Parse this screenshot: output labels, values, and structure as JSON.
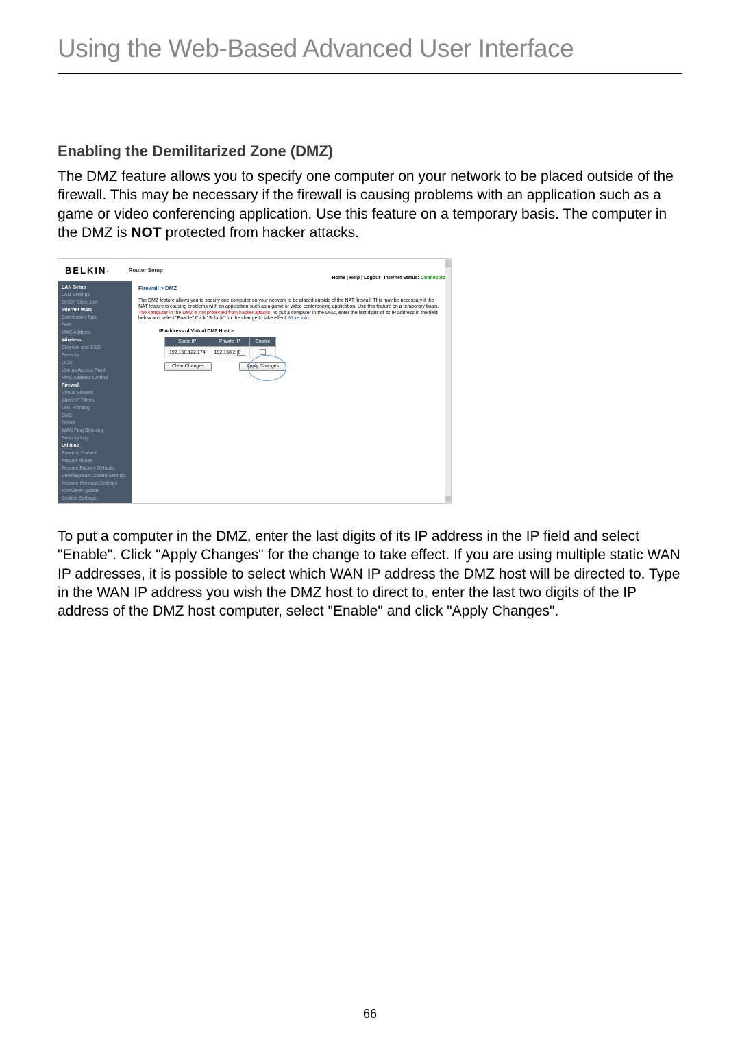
{
  "page": {
    "title": "Using the Web-Based Advanced User Interface",
    "section_heading": "Enabling the Demilitarized Zone (DMZ)",
    "intro_p1": "The DMZ feature allows you to specify one computer on your network to be placed outside of the firewall. This may be necessary if the firewall is causing problems with an application such as a game or video conferencing application. Use this feature on a temporary basis. The computer in the DMZ is ",
    "intro_bold": "NOT",
    "intro_p2": " protected from hacker attacks.",
    "outro": "To put a computer in the DMZ, enter the last digits of its IP address in the IP field and select \"Enable\". Click \"Apply Changes\" for the change to take effect. If you are using multiple static WAN IP addresses, it is possible to select which WAN IP address the DMZ host will be directed to. Type in the WAN IP address you wish the DMZ host to direct to, enter the last two digits of the IP address of the DMZ host computer, select \"Enable\" and click \"Apply Changes\".",
    "page_number": "66"
  },
  "router": {
    "brand": "BELKIN",
    "brand_suffix": ".",
    "setup_label": "Router Setup",
    "header_links": "Home | Help | Logout",
    "status_label": "Internet Status:",
    "status_value": "Connected",
    "breadcrumb": "Firewall > DMZ",
    "desc_part1": "The DMZ feature allows you to specify one computer on your network to be placed outside of the NAT firewall. This may be necessary if the NAT feature is causing problems with an application such as a game or video conferencing application. Use this feature on a temporary basis.",
    "desc_red": "The computer in the DMZ is not protected from hacker attacks.",
    "desc_part2": " To put a computer in the DMZ, enter the last digits of its IP address in the field below and select \"Enable\".Click \"Submit\" for the change to take effect. ",
    "desc_link": "More Info",
    "table_title": "IP Address of Virtual DMZ Host >",
    "headers": {
      "static": "Static IP",
      "private": "Private IP",
      "enable": "Enable"
    },
    "row": {
      "static_ip": "192.168.122.174",
      "private_prefix": "192.168.2.",
      "private_last": "0"
    },
    "buttons": {
      "clear": "Clear Changes",
      "apply": "Apply Changes"
    }
  },
  "sidebar": {
    "s1": "LAN Setup",
    "s1_items": [
      "LAN Settings",
      "DHCP Client List"
    ],
    "s2": "Internet WAN",
    "s2_items": [
      "Connection Type",
      "DNS",
      "MAC Address"
    ],
    "s3": "Wireless",
    "s3_items": [
      "Channel and SSID",
      "Security",
      "QOS",
      "Use as Access Point",
      "MAC Address Control"
    ],
    "s4": "Firewall",
    "s4_items": [
      "Virtual Servers",
      "Client IP Filters",
      "URL Blocking",
      "DMZ",
      "DDNS",
      "WAN Ping Blocking",
      "Security Log"
    ],
    "s5": "Utilities",
    "s5_items": [
      "Parental Control",
      "Restart Router",
      "Restore Factory Defaults",
      "Save/Backup Current Settings",
      "Restore Previous Settings",
      "Firmware Update",
      "System Settings"
    ]
  }
}
